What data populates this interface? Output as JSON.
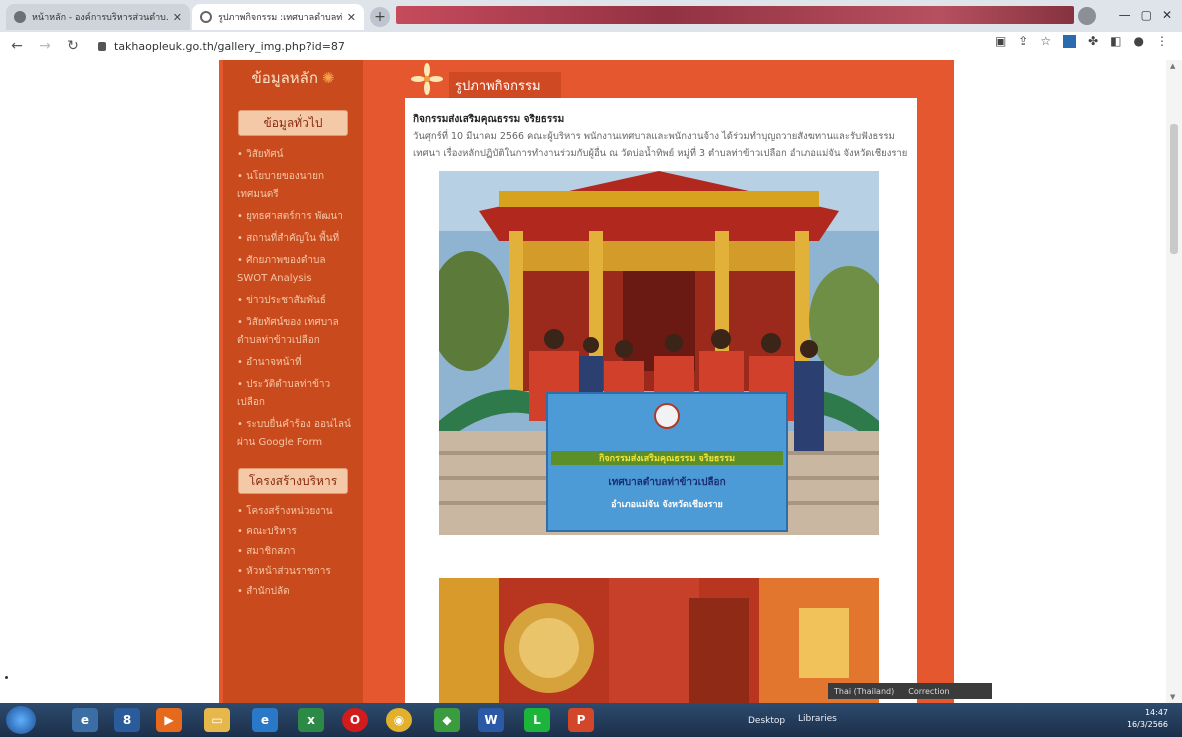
{
  "browser": {
    "tabs": [
      {
        "label": "หน้าหลัก - องค์การบริหารส่วนตำบ...",
        "active": false
      },
      {
        "label": "รูปภาพกิจกรรม :เทศบาลตำบลท่า:",
        "active": true
      }
    ],
    "new_tab": "+",
    "url": "takhaopleuk.go.th/gallery_img.php?id=87"
  },
  "site": {
    "sidebar": {
      "header": "ข้อมูลหลัก",
      "section1_title": "ข้อมูลทั่วไป",
      "section1_items": [
        "• วิสัยทัศน์",
        "• นโยบายของนายก เทศมนตรี",
        "• ยุทธศาสตร์การ พัฒนา",
        "• สถานที่สำคัญใน พื้นที่",
        "• ศักยภาพของตำบล SWOT Analysis",
        "• ข่าวประชาสัมพันธ์",
        "• วิสัยทัศน์ของ เทศบาลตำบลท่าข้าวเปลือก",
        "• อำนาจหน้าที่",
        "• ประวัติตำบลท่าข้าว เปลือก",
        "• ระบบยื่นคำร้อง ออนไลน์ ผ่าน Google Form"
      ],
      "section2_title": "โครงสร้างบริหาร",
      "section2_items": [
        "• โครงสร้างหน่วยงาน",
        "• คณะบริหาร",
        "• สมาชิกสภา",
        "• หัวหน้าส่วนราชการ",
        "• สำนักปลัด"
      ]
    },
    "main": {
      "header": "รูปภาพกิจกรรม",
      "activity_title": "กิจกรรมส่งเสริมคุณธรรม จริยธรรม",
      "activity_desc": "วันศุกร์ที่ 10 มีนาคม 2566 คณะผู้บริหาร พนักงานเทศบาลและพนักงานจ้าง ได้ร่วมทำบุญถวายสังฆทานและรับฟังธรรม เทศนา เรื่องหลักปฏิบัติในการทำงานร่วมกับผู้อื่น ณ วัดบ่อน้ำทิพย์ หมู่ที่ 3 ตำบลท่าข้าวเปลือก อำเภอแม่จัน จังหวัดเชียงราย",
      "banner_line1": "กิจกรรมส่งเสริมคุณธรรม จริยธรรม",
      "banner_line2": "เทศบาลตำบลท่าข้าวเปลือก",
      "banner_line3": "อำเภอแม่จัน จังหวัดเชียงราย"
    }
  },
  "taskbar": {
    "desktop": "Desktop",
    "libraries": "Libraries",
    "lang": "Thai (Thailand)",
    "correction": "Correction",
    "time": "14:47",
    "date": "16/3/2566",
    "apps": [
      "start",
      "ie-old",
      "8",
      "media",
      "folder",
      "ie",
      "excel",
      "opera",
      "chrome",
      "line-green",
      "word",
      "line",
      "powerpoint"
    ]
  },
  "colors": {
    "site_bg": "#e5572f",
    "sidebar_bg": "#c84a1d",
    "sidebar_text": "#f6c7a5",
    "accent": "#cf4a22"
  }
}
